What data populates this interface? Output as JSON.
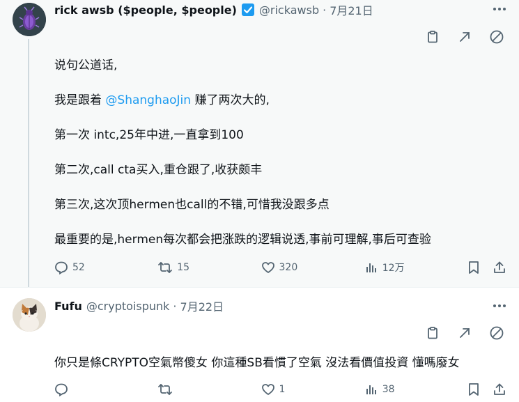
{
  "colors": {
    "accent": "#1d9bf0",
    "muted": "#536471",
    "text": "#0f1419",
    "verified": "#1d9bf0"
  },
  "posts": [
    {
      "author": "rick awsb ($people, $people)",
      "handle": "@rickawsb",
      "separator": "·",
      "time": "7月21日",
      "verified": true,
      "avatar_icon": "beetle-avatar",
      "paragraphs": [
        {
          "text": "说句公道话,"
        },
        {
          "before": "我是跟着 ",
          "mention": "@ShanghaoJin",
          "after": " 赚了两次大的,"
        },
        {
          "text": "第一次 intc,25年中进,一直拿到100"
        },
        {
          "text": "第二次,call cta买入,重仓跟了,收获颇丰"
        },
        {
          "text": "第三次,这次顶hermen也call的不错,可惜我没跟多点"
        },
        {
          "text": "最重要的是,hermen每次都会把涨跌的逻辑说透,事前可理解,事后可查验"
        }
      ],
      "stats": {
        "replies": "52",
        "reposts": "15",
        "likes": "320",
        "views": "12万"
      }
    },
    {
      "author": "Fufu",
      "handle": "@cryptoispunk",
      "separator": "·",
      "time": "7月22日",
      "verified": false,
      "avatar_icon": "cat-avatar",
      "paragraphs": [
        {
          "text": "你只是條CRYPTO空氣幣傻女 你這種SB看慣了空氣 沒法看價值投資 懂嗎廢女"
        }
      ],
      "stats": {
        "replies": "",
        "reposts": "",
        "likes": "1",
        "views": "38"
      }
    }
  ]
}
